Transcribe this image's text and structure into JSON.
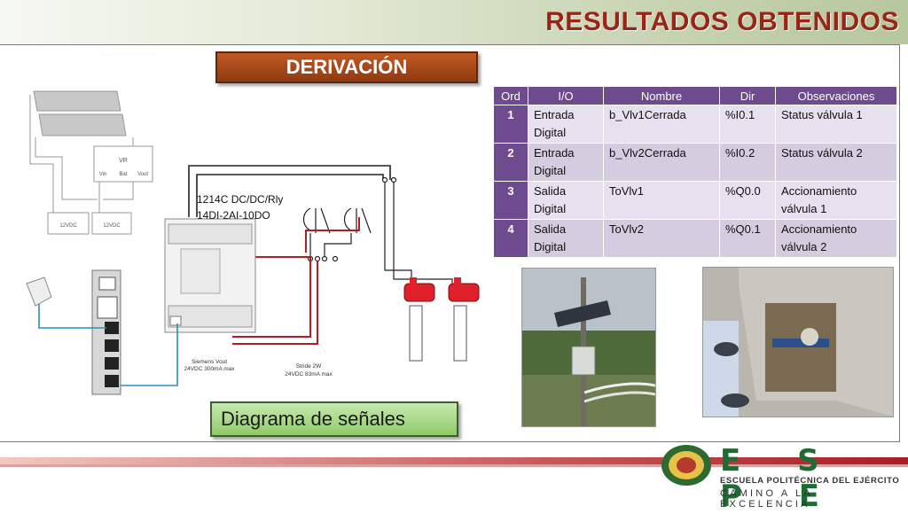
{
  "slide": {
    "title": "RESULTADOS OBTENIDOS",
    "section": "DERIVACIÓN",
    "caption": "Diagrama de señales"
  },
  "diagram": {
    "vr_label": "VR",
    "vr_vin": "Vin",
    "vr_bat": "Bat",
    "vr_vout": "Vout",
    "battery1": "12VDC",
    "battery2": "12VDC",
    "plc_label_line1": "1214C DC/DC/Rly",
    "plc_label_line2": "14DI-2AI-10DO",
    "siemens_line1": "Siemens Vout",
    "siemens_line2": "24VDC 300mA max",
    "stride_line1": "Stride 2W",
    "stride_line2": "24VDC 83mA max"
  },
  "table": {
    "headers": [
      "Ord",
      "I/O",
      "Nombre",
      "Dir",
      "Observaciones"
    ],
    "rows": [
      {
        "ord": "1",
        "io1": "Entrada",
        "io2": "Digital",
        "nombre": "b_Vlv1Cerrada",
        "dir": "%I0.1",
        "obs1": "Status válvula 1",
        "obs2": ""
      },
      {
        "ord": "2",
        "io1": "Entrada",
        "io2": "Digital",
        "nombre": "b_Vlv2Cerrada",
        "dir": "%I0.2",
        "obs1": "Status válvula 2",
        "obs2": ""
      },
      {
        "ord": "3",
        "io1": "Salida",
        "io2": "Digital",
        "nombre": "ToVlv1",
        "dir": "%Q0.0",
        "obs1": "Accionamiento",
        "obs2": "válvula 1"
      },
      {
        "ord": "4",
        "io1": "Salida",
        "io2": "Digital",
        "nombre": "ToVlv2",
        "dir": "%Q0.1",
        "obs1": "Accionamiento",
        "obs2": "válvula 2"
      }
    ]
  },
  "logo": {
    "name": "E S P E",
    "line1": "ESCUELA POLITÉCNICA DEL EJÉRCITO",
    "line2": "CAMINO A LA EXCELENCIA"
  },
  "colors": {
    "title": "#9a2515",
    "table_header": "#6e4a8e",
    "wire_red": "#b02020",
    "wire_blue": "#2f8fb5",
    "logo_green": "#1f6b34"
  }
}
